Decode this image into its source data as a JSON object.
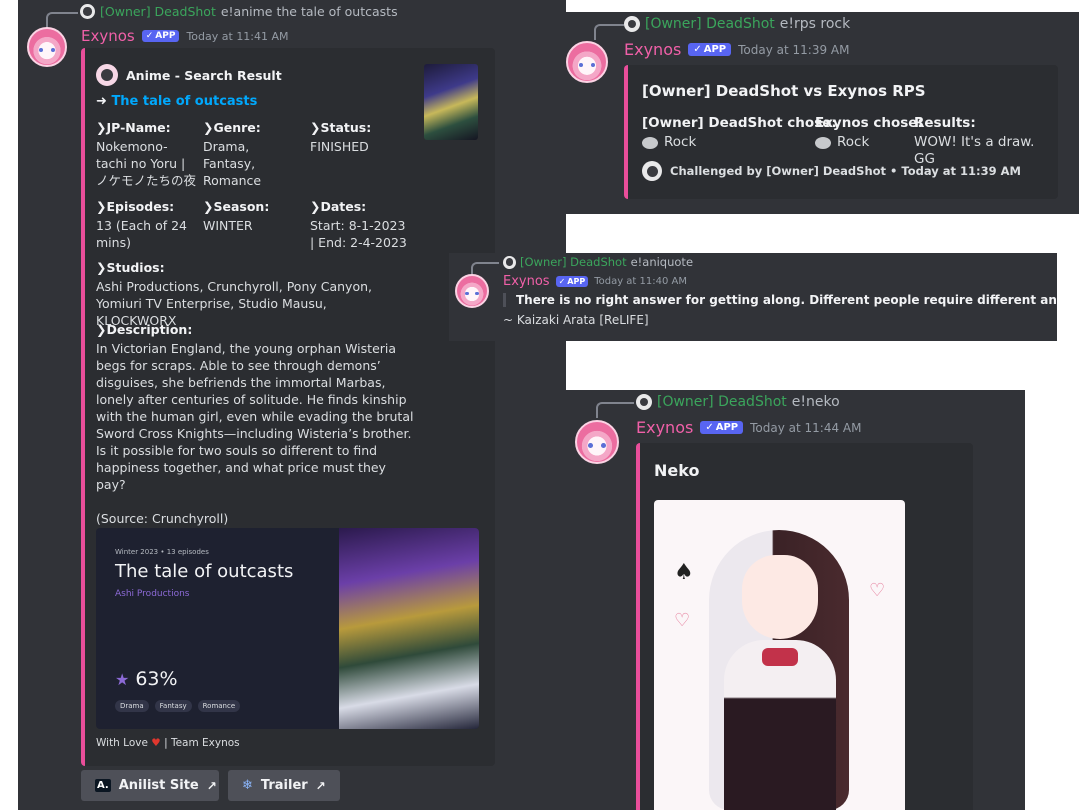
{
  "anime": {
    "reply": {
      "owner": "[Owner] DeadShot",
      "command": "e!anime the tale of outcasts"
    },
    "bot_name": "Exynos",
    "badge": "APP",
    "timestamp": "Today at 11:41 AM",
    "embed": {
      "author": "Anime - Search Result",
      "title_arrow": "➜",
      "title": "The tale of outcasts",
      "fields": [
        {
          "label": "❯JP-Name:",
          "value": "Nokemono-tachi no Yoru | ノケモノたちの夜"
        },
        {
          "label": "❯Genre:",
          "value": "Drama, Fantasy, Romance"
        },
        {
          "label": "❯Status:",
          "value": "FINISHED"
        },
        {
          "label": "❯Episodes:",
          "value": "13 (Each of 24 mins)"
        },
        {
          "label": "❯Season:",
          "value": "WINTER"
        },
        {
          "label": "❯Dates:",
          "value": "Start: 8-1-2023 | End: 2-4-2023"
        }
      ],
      "studios_label": "❯Studios:",
      "studios": "Ashi Productions, Crunchyroll, Pony Canyon, Yomiuri TV Enterprise, Studio Mausu, KLOCKWORX",
      "description_label": "❯Description:",
      "description": "In Victorian England, the young orphan Wisteria begs for scraps. Able to see through demons’ disguises, she befriends the immortal Marbas, lonely after centuries of solitude. He finds kinship with the human girl, even while evading the brutal Sword Cross Knights—including Wisteria’s brother. Is it possible for two souls so different to find happiness together, and what price must they pay?",
      "source": "(Source: Crunchyroll)",
      "card": {
        "meta": "Winter 2023 • 13 episodes",
        "title": "The tale of outcasts",
        "studio": "Ashi Productions",
        "score": "63%",
        "tags": [
          "Drama",
          "Fantasy",
          "Romance"
        ]
      },
      "footer_a": "With Love",
      "footer_b": "| Team Exynos"
    },
    "buttons": [
      {
        "icon": "anilist-icon",
        "glyph": "A.",
        "label": "Anilist Site"
      },
      {
        "icon": "snowflake-icon",
        "glyph": "❄",
        "label": "Trailer"
      }
    ]
  },
  "rps": {
    "reply": {
      "owner": "[Owner] DeadShot",
      "command": "e!rps rock"
    },
    "bot_name": "Exynos",
    "badge": "APP",
    "timestamp": "Today at 11:39 AM",
    "embed": {
      "title": "[Owner] DeadShot vs Exynos RPS",
      "fields": [
        {
          "label": "[Owner] DeadShot chose:",
          "value": "Rock",
          "icon": "rock-icon"
        },
        {
          "label": "Exynos chose:",
          "value": "Rock",
          "icon": "rock-icon"
        },
        {
          "label": "Results:",
          "value": "WOW! It's a draw. GG"
        }
      ],
      "footer": "Challenged by [Owner] DeadShot • Today at 11:39 AM"
    }
  },
  "quote": {
    "reply": {
      "owner": "[Owner] DeadShot",
      "command": "e!aniquote"
    },
    "bot_name": "Exynos",
    "badge": "APP",
    "timestamp": "Today at 11:40 AM",
    "quote": "There is no right answer for getting along. Different people require different answers.",
    "attribution": "~ Kaizaki Arata [ReLIFE]"
  },
  "neko": {
    "reply": {
      "owner": "[Owner] DeadShot",
      "command": "e!neko"
    },
    "bot_name": "Exynos",
    "badge": "APP",
    "timestamp": "Today at 11:44 AM",
    "title": "Neko"
  },
  "colors": {
    "accent": "#e94e9a",
    "link": "#00a8fc",
    "owner": "#3ba55c",
    "bot": "#f060a8",
    "badge": "#5865f2"
  }
}
